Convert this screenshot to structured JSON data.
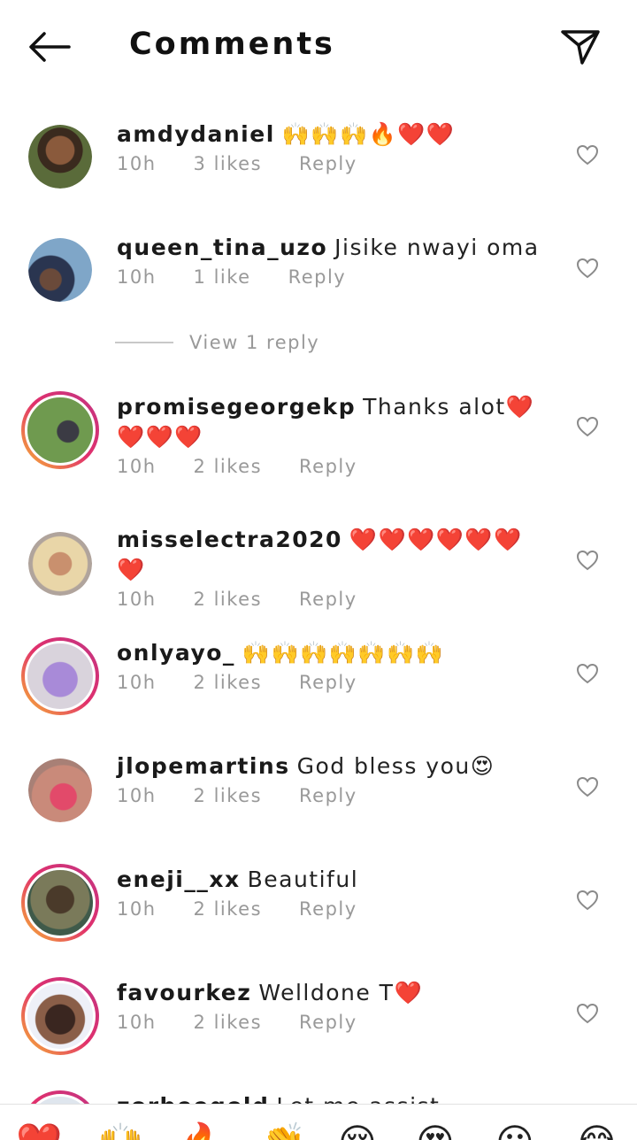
{
  "header": {
    "title": "Comments"
  },
  "comments": [
    {
      "username": "amdydaniel",
      "text": "🙌🙌🙌🔥❤️❤️",
      "time": "10h",
      "likes": "3 likes",
      "reply": "Reply"
    },
    {
      "username": "queen_tina_uzo",
      "text": "Jisike nwayi oma",
      "time": "10h",
      "likes": "1 like",
      "reply": "Reply"
    },
    {
      "username": "promisegeorgekp",
      "text": "Thanks alot❤️❤️❤️❤️",
      "time": "10h",
      "likes": "2 likes",
      "reply": "Reply"
    },
    {
      "username": "misselectra2020",
      "text": "❤️❤️❤️❤️❤️❤️❤️",
      "time": "10h",
      "likes": "2 likes",
      "reply": "Reply"
    },
    {
      "username": "onlyayo_",
      "text": "🙌🙌🙌🙌🙌🙌🙌",
      "time": "10h",
      "likes": "2 likes",
      "reply": "Reply"
    },
    {
      "username": "jlopemartins",
      "text": "God bless you😍",
      "time": "10h",
      "likes": "2 likes",
      "reply": "Reply"
    },
    {
      "username": "eneji__xx",
      "text": "Beautiful",
      "time": "10h",
      "likes": "2 likes",
      "reply": "Reply"
    },
    {
      "username": "favourkez",
      "text": "Welldone T❤️",
      "time": "10h",
      "likes": "2 likes",
      "reply": "Reply"
    },
    {
      "username": "zorbeegold",
      "text": "Let me assist",
      "time": "",
      "likes": "",
      "reply": ""
    }
  ],
  "view_replies": {
    "label": "View 1 reply"
  },
  "quick_reactions": [
    "❤️",
    "🙌",
    "🔥",
    "👏",
    "😢",
    "😍",
    "😮",
    "😂"
  ]
}
